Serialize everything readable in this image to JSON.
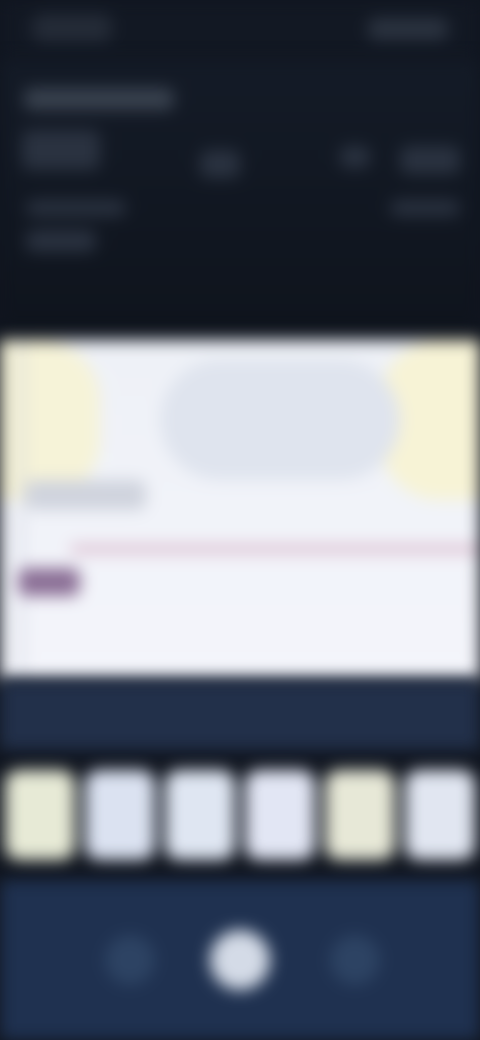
{
  "status_bar": {},
  "weather_card": {},
  "chart": {},
  "tiles": [
    {
      "color": "#e7ead6"
    },
    {
      "color": "#dbe2f1"
    },
    {
      "color": "#dfe6f2"
    },
    {
      "color": "#e2e6f4"
    },
    {
      "color": "#e7e8d7"
    },
    {
      "color": "#e1e6f1"
    }
  ],
  "nav": {}
}
